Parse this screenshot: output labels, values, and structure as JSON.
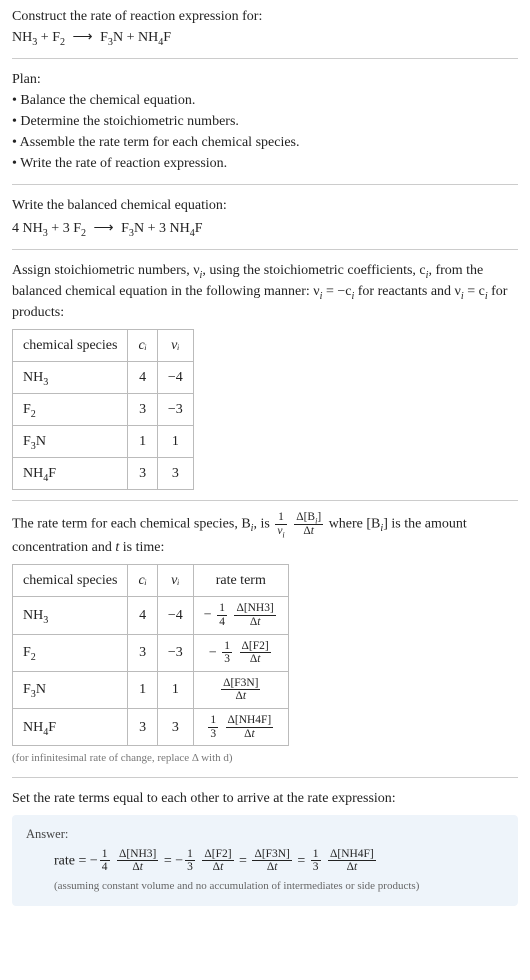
{
  "prompt": {
    "line1": "Construct the rate of reaction expression for:",
    "eq_lhs1": "NH",
    "eq_lhs1_sub": "3",
    "plus1": " + ",
    "eq_lhs2": "F",
    "eq_lhs2_sub": "2",
    "arrow": "⟶",
    "eq_rhs1": "F",
    "eq_rhs1_sub": "3",
    "eq_rhs1b": "N",
    "plus2": " + ",
    "eq_rhs2": "NH",
    "eq_rhs2_sub": "4",
    "eq_rhs2b": "F"
  },
  "plan": {
    "title": "Plan:",
    "items": [
      "• Balance the chemical equation.",
      "• Determine the stoichiometric numbers.",
      "• Assemble the rate term for each chemical species.",
      "• Write the rate of reaction expression."
    ]
  },
  "balanced": {
    "intro": "Write the balanced chemical equation:",
    "c1": "4 ",
    "s1": "NH",
    "s1sub": "3",
    "plus1": " + ",
    "c2": "3 ",
    "s2": "F",
    "s2sub": "2",
    "arrow": "⟶",
    "s3": "F",
    "s3sub": "3",
    "s3b": "N",
    "plus2": " + ",
    "c4": "3 ",
    "s4": "NH",
    "s4sub": "4",
    "s4b": "F"
  },
  "stoich_intro": {
    "p1": "Assign stoichiometric numbers, ν",
    "p1sub": "i",
    "p2": ", using the stoichiometric coefficients, c",
    "p2sub": "i",
    "p3": ", from the balanced chemical equation in the following manner: ν",
    "p3sub": "i",
    "p4": " = −c",
    "p4sub": "i",
    "p5": " for reactants and ν",
    "p5sub": "i",
    "p6": " = c",
    "p6sub": "i",
    "p7": " for products:"
  },
  "stoich_table": {
    "headers": {
      "h1": "chemical species",
      "h2": "cᵢ",
      "h3": "νᵢ"
    },
    "rows": [
      {
        "sp": "NH",
        "sub": "3",
        "after": "",
        "ci": "4",
        "vi": "−4"
      },
      {
        "sp": "F",
        "sub": "2",
        "after": "",
        "ci": "3",
        "vi": "−3"
      },
      {
        "sp": "F",
        "sub": "3",
        "after": "N",
        "ci": "1",
        "vi": "1"
      },
      {
        "sp": "NH",
        "sub": "4",
        "after": "F",
        "ci": "3",
        "vi": "3"
      }
    ]
  },
  "rate_intro": {
    "p1": "The rate term for each chemical species, B",
    "p1sub": "i",
    "p2": ", is ",
    "f1num": "1",
    "f1den_a": "ν",
    "f1den_sub": "i",
    "f2num_a": "Δ[B",
    "f2num_sub": "i",
    "f2num_b": "]",
    "f2den_a": "Δ",
    "f2den_b": "t",
    "p3": " where [B",
    "p3sub": "i",
    "p4": "] is the amount concentration and ",
    "p5": "t",
    "p6": " is time:"
  },
  "rate_table": {
    "headers": {
      "h1": "chemical species",
      "h2": "cᵢ",
      "h3": "νᵢ",
      "h4": "rate term"
    },
    "rows": [
      {
        "sp": "NH",
        "sub": "3",
        "after": "",
        "ci": "4",
        "vi": "−4",
        "neg": "−",
        "n1": "1",
        "d1": "4",
        "conc": "Δ[NH3]",
        "dt": "Δt"
      },
      {
        "sp": "F",
        "sub": "2",
        "after": "",
        "ci": "3",
        "vi": "−3",
        "neg": "−",
        "n1": "1",
        "d1": "3",
        "conc": "Δ[F2]",
        "dt": "Δt"
      },
      {
        "sp": "F",
        "sub": "3",
        "after": "N",
        "ci": "1",
        "vi": "1",
        "neg": "",
        "n1": "",
        "d1": "",
        "conc": "Δ[F3N]",
        "dt": "Δt"
      },
      {
        "sp": "NH",
        "sub": "4",
        "after": "F",
        "ci": "3",
        "vi": "3",
        "neg": "",
        "n1": "1",
        "d1": "3",
        "conc": "Δ[NH4F]",
        "dt": "Δt"
      }
    ],
    "note": "(for infinitesimal rate of change, replace Δ with d)"
  },
  "set_intro": "Set the rate terms equal to each other to arrive at the rate expression:",
  "answer": {
    "label": "Answer:",
    "rate_word": "rate = ",
    "t1": {
      "neg": "−",
      "n": "1",
      "d": "4",
      "conc": "Δ[NH3]",
      "dt": "Δt"
    },
    "eq1": " = ",
    "t2": {
      "neg": "−",
      "n": "1",
      "d": "3",
      "conc": "Δ[F2]",
      "dt": "Δt"
    },
    "eq2": " = ",
    "t3": {
      "neg": "",
      "n": "",
      "d": "",
      "conc": "Δ[F3N]",
      "dt": "Δt"
    },
    "eq3": " = ",
    "t4": {
      "neg": "",
      "n": "1",
      "d": "3",
      "conc": "Δ[NH4F]",
      "dt": "Δt"
    },
    "assume": "(assuming constant volume and no accumulation of intermediates or side products)"
  }
}
